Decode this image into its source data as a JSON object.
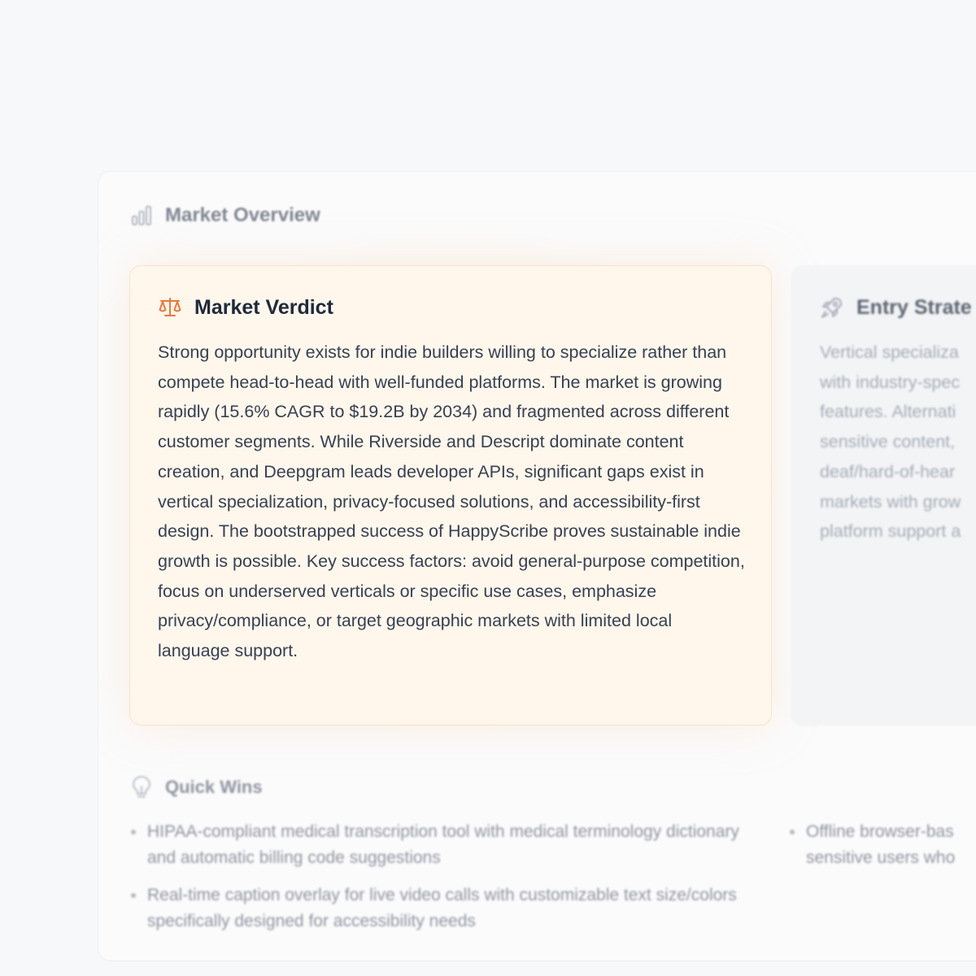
{
  "overview": {
    "title": "Market Overview",
    "icon": "bar-chart-icon"
  },
  "verdict": {
    "title": "Market Verdict",
    "icon": "scale-icon",
    "accent": "#e8793a",
    "text": "Strong opportunity exists for indie builders willing to specialize rather than compete head-to-head with well-funded platforms. The market is growing rapidly (15.6% CAGR to $19.2B by 2034) and fragmented across different customer segments. While Riverside and Descript dominate content creation, and Deepgram leads developer APIs, significant gaps exist in vertical specialization, privacy-focused solutions, and accessibility-first design. The bootstrapped success of HappyScribe proves sustainable indie growth is possible. Key success factors: avoid general-purpose competition, focus on underserved verticals or specific use cases, emphasize privacy/compliance, or target geographic markets with limited local language support."
  },
  "entry": {
    "title": "Entry Strate",
    "icon": "rocket-icon",
    "lines": [
      "Vertical specializa",
      "with industry-spec",
      "features. Alternati",
      "sensitive content,",
      "deaf/hard-of-hear",
      "markets with grow",
      "platform support a"
    ]
  },
  "quick_wins": {
    "title": "Quick Wins",
    "icon": "lightbulb-icon",
    "items": [
      "HIPAA-compliant medical transcription tool with medical terminology dictionary and automatic billing code suggestions",
      "Real-time caption overlay for live video calls with customizable text size/colors specifically designed for accessibility needs",
      "Offline browser-bas sensitive users who"
    ]
  }
}
